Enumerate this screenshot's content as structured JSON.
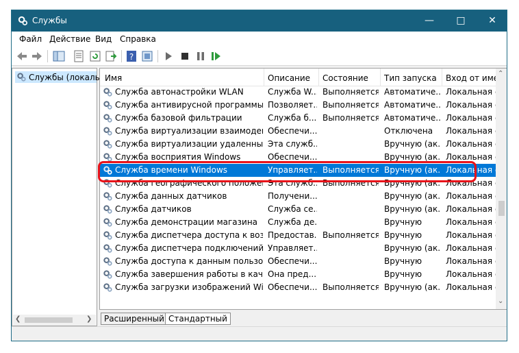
{
  "window": {
    "title": "Службы"
  },
  "menu": [
    "Файл",
    "Действие",
    "Вид",
    "Справка"
  ],
  "tree": {
    "root_label": "Службы (локалы"
  },
  "columns": [
    "Имя",
    "Описание",
    "Состояние",
    "Тип запуска",
    "Вход от имен"
  ],
  "rows": [
    {
      "name": "Служба автонастройки WLAN",
      "desc": "Служба W...",
      "state": "Выполняется",
      "startup": "Автоматиче...",
      "logon": "Локальная си"
    },
    {
      "name": "Служба антивирусной программы ...",
      "desc": "Позволяет...",
      "state": "Выполняется",
      "startup": "Автоматиче...",
      "logon": "Локальная си"
    },
    {
      "name": "Служба базовой фильтрации",
      "desc": "Служба б...",
      "state": "Выполняется",
      "startup": "Автоматиче...",
      "logon": "Локальная сл"
    },
    {
      "name": "Служба виртуализации взаимодейст...",
      "desc": "Обеспечи...",
      "state": "",
      "startup": "Отключена",
      "logon": "Локальная си"
    },
    {
      "name": "Служба виртуализации удаленных р...",
      "desc": "Эта служб...",
      "state": "",
      "startup": "Вручную (ак...",
      "logon": "Локальная си"
    },
    {
      "name": "Служба восприятия Windows",
      "desc": "Обеспечи...",
      "state": "",
      "startup": "Вручную (ак...",
      "logon": "Локальная сл"
    },
    {
      "name": "Служба времени Windows",
      "desc": "Управляет...",
      "state": "Выполняется",
      "startup": "Вручную (ак...",
      "logon": "Локальная сл",
      "selected": true
    },
    {
      "name": "Служба географического положения",
      "desc": "Эта служб...",
      "state": "Выполняется",
      "startup": "Вручную (ак...",
      "logon": "Локальная си"
    },
    {
      "name": "Служба данных датчиков",
      "desc": "Получени...",
      "state": "",
      "startup": "Вручную (ак...",
      "logon": "Локальная си"
    },
    {
      "name": "Служба датчиков",
      "desc": "Служба се...",
      "state": "",
      "startup": "Вручную (ак...",
      "logon": "Локальная си"
    },
    {
      "name": "Служба демонстрации магазина",
      "desc": "Служба де...",
      "state": "",
      "startup": "Вручную",
      "logon": "Локальная си"
    },
    {
      "name": "Служба диспетчера доступа к возмо...",
      "desc": "Предостав...",
      "state": "Выполняется",
      "startup": "Вручную",
      "logon": "Локальная си"
    },
    {
      "name": "Служба диспетчера подключений сл...",
      "desc": "Управляет...",
      "state": "",
      "startup": "Вручную (ак...",
      "logon": "Локальная си"
    },
    {
      "name": "Служба доступа к данным пользоват...",
      "desc": "Обеспечи...",
      "state": "",
      "startup": "Вручную",
      "logon": "Локальная си"
    },
    {
      "name": "Служба завершения работы в качест...",
      "desc": "Она пред...",
      "state": "",
      "startup": "Вручную",
      "logon": "Локальная си"
    },
    {
      "name": "Служба загрузки изображений Wind...",
      "desc": "Обеспечи...",
      "state": "Выполняется",
      "startup": "Вручную (ак...",
      "logon": "Локальная сл"
    }
  ],
  "tabs": [
    "Расширенный",
    "Стандартный"
  ],
  "colors": {
    "titlebar": "#17607e",
    "selection": "#0078d7",
    "highlight": "#e8131a"
  }
}
